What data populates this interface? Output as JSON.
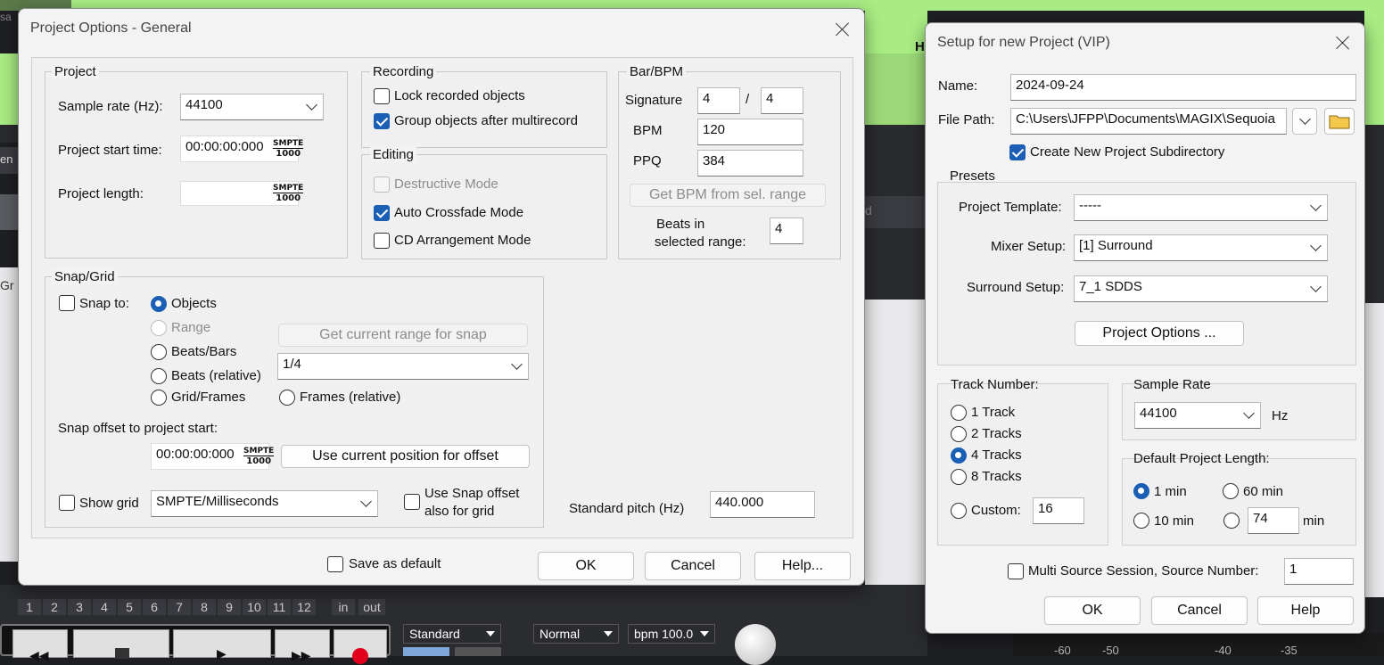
{
  "project_options": {
    "title": "Project Options - General",
    "project": {
      "group": "Project",
      "sample_rate_label": "Sample rate (Hz):",
      "sample_rate_value": "44100",
      "start_time_label": "Project start time:",
      "start_time_value": "00:00:00:000",
      "length_label": "Project length:",
      "length_value": "",
      "smpte_top": "SMPTE",
      "smpte_bottom": "1000"
    },
    "recording": {
      "group": "Recording",
      "lock_label": "Lock recorded objects",
      "group_objects_label": "Group objects after multirecord"
    },
    "editing": {
      "group": "Editing",
      "destructive_label": "Destructive Mode",
      "crossfade_label": "Auto Crossfade Mode",
      "cd_label": "CD Arrangement Mode"
    },
    "bar_bpm": {
      "group": "Bar/BPM",
      "signature_label": "Signature",
      "sig_num": "4",
      "sig_sep": "/",
      "sig_den": "4",
      "bpm_label": "BPM",
      "bpm_value": "120",
      "ppq_label": "PPQ",
      "ppq_value": "384",
      "get_bpm_button": "Get BPM from sel. range",
      "beats_label_1": "Beats in",
      "beats_label_2": "selected range:",
      "beats_value": "4"
    },
    "snap": {
      "group": "Snap/Grid",
      "snap_to_label": "Snap to:",
      "objects": "Objects",
      "range": "Range",
      "beats_bars": "Beats/Bars",
      "beats_relative": "Beats (relative)",
      "grid_frames": "Grid/Frames",
      "frames_relative": "Frames (relative)",
      "get_range_button": "Get current range for snap",
      "snap_value": "1/4",
      "offset_label": "Snap offset to project start:",
      "offset_value": "00:00:00:000",
      "use_position_button": "Use current position for offset",
      "show_grid_label": "Show grid",
      "grid_value": "SMPTE/Milliseconds",
      "use_snap_1": "Use Snap offset",
      "use_snap_2": "also for grid"
    },
    "pitch_label": "Standard pitch (Hz)",
    "pitch_value": "440.000",
    "save_default_label": "Save as default",
    "ok": "OK",
    "cancel": "Cancel",
    "help": "Help..."
  },
  "setup": {
    "title": "Setup for new Project (VIP)",
    "name_label": "Name:",
    "name_value": "2024-09-24",
    "path_label": "File Path:",
    "path_value": "C:\\Users\\JFPP\\Documents\\MAGIX\\Sequoia",
    "subdir_label": "Create New Project Subdirectory",
    "presets_label": "Presets",
    "template_label": "Project Template:",
    "template_value": "-----",
    "mixer_label": "Mixer Setup:",
    "mixer_value": "[1] Surround",
    "surround_label": "Surround Setup:",
    "surround_value": "7_1 SDDS",
    "project_options_button": "Project Options ...",
    "track_number_label": "Track Number:",
    "tracks": [
      "1 Track",
      "2 Tracks",
      "4 Tracks",
      "8 Tracks"
    ],
    "custom_label": "Custom:",
    "custom_value": "16",
    "sample_rate_label": "Sample Rate",
    "sample_rate_value": "44100",
    "hz": "Hz",
    "default_length_label": "Default Project Length:",
    "len_1": "1 min",
    "len_60": "60 min",
    "len_10": "10 min",
    "len_custom": "74",
    "len_unit": "min",
    "multi_label": "Multi Source Session, Source Number:",
    "multi_value": "1",
    "ok": "OK",
    "cancel": "Cancel",
    "help": "Help"
  },
  "daw": {
    "keys": [
      "1",
      "2",
      "3",
      "4",
      "5",
      "6",
      "7",
      "8",
      "9",
      "10",
      "11",
      "12"
    ],
    "in": "in",
    "out": "out",
    "standard": "Standard",
    "normal": "Normal",
    "bpm": "bpm 100.0",
    "scale": [
      "-60",
      "-50",
      "-40",
      "-35"
    ],
    "frag_h": "H",
    "frag_sa": "sa",
    "frag_en": "en",
    "frag_gr": "Gr",
    "frag_d": "d"
  },
  "colors": {
    "accent": "#1a5fb4",
    "clip_green": "#a8ec83"
  }
}
